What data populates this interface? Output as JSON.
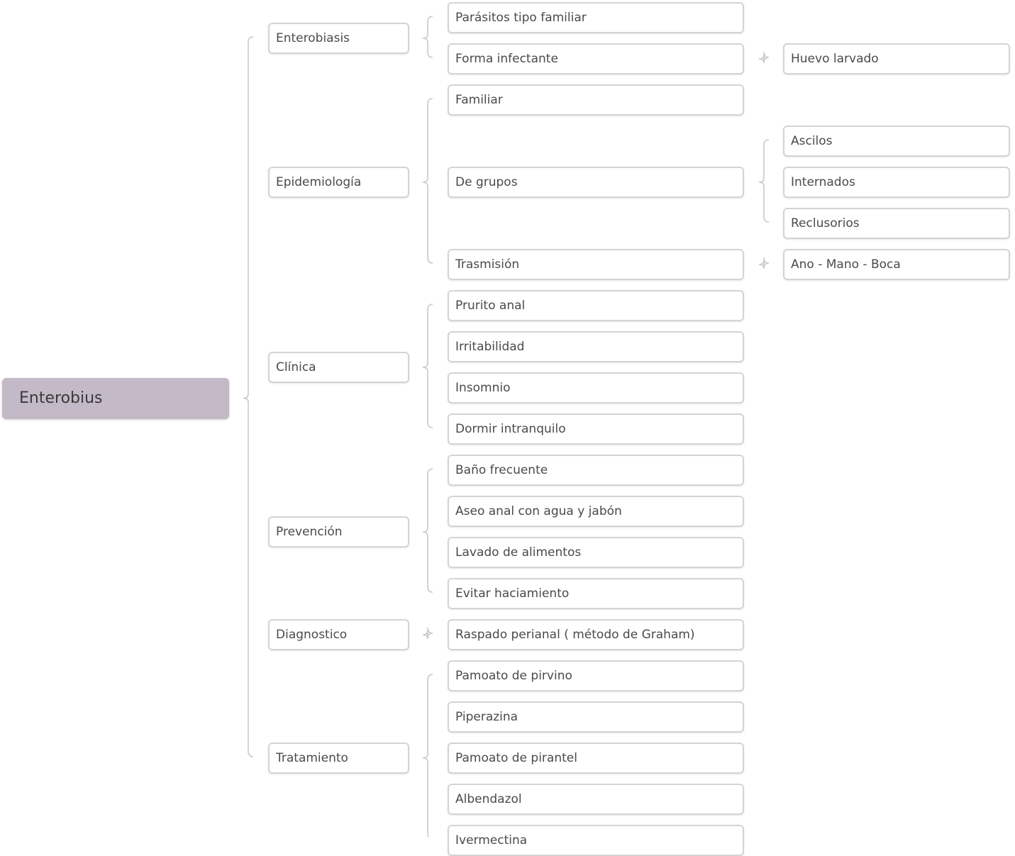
{
  "root": {
    "label": "Enterobius",
    "children": [
      {
        "label": "Enterobiasis",
        "children": [
          {
            "label": "Parásitos tipo familiar"
          },
          {
            "label": "Forma infectante",
            "children": [
              {
                "label": "Huevo larvado"
              }
            ]
          }
        ]
      },
      {
        "label": "Epidemiología",
        "children": [
          {
            "label": "Familiar"
          },
          {
            "label": "De grupos",
            "children": [
              {
                "label": "Ascilos"
              },
              {
                "label": "Internados"
              },
              {
                "label": "Reclusorios"
              }
            ]
          },
          {
            "label": "Trasmisión",
            "children": [
              {
                "label": "Ano - Mano - Boca"
              }
            ]
          }
        ]
      },
      {
        "label": "Clínica",
        "children": [
          {
            "label": "Prurito anal"
          },
          {
            "label": "Irritabilidad"
          },
          {
            "label": "Insomnio"
          },
          {
            "label": "Dormir intranquilo"
          }
        ]
      },
      {
        "label": "Prevención",
        "children": [
          {
            "label": "Baño frecuente"
          },
          {
            "label": "Aseo anal con agua y jabón"
          },
          {
            "label": "Lavado de alimentos"
          },
          {
            "label": "Evitar haciamiento"
          }
        ]
      },
      {
        "label": "Diagnostico",
        "children": [
          {
            "label": "Raspado perianal ( método de Graham)"
          }
        ]
      },
      {
        "label": "Tratamiento",
        "children": [
          {
            "label": "Pamoato de pirvino"
          },
          {
            "label": "Piperazina"
          },
          {
            "label": "Pamoato de pirantel"
          },
          {
            "label": "Albendazol"
          },
          {
            "label": "Ivermectina"
          }
        ]
      }
    ]
  }
}
